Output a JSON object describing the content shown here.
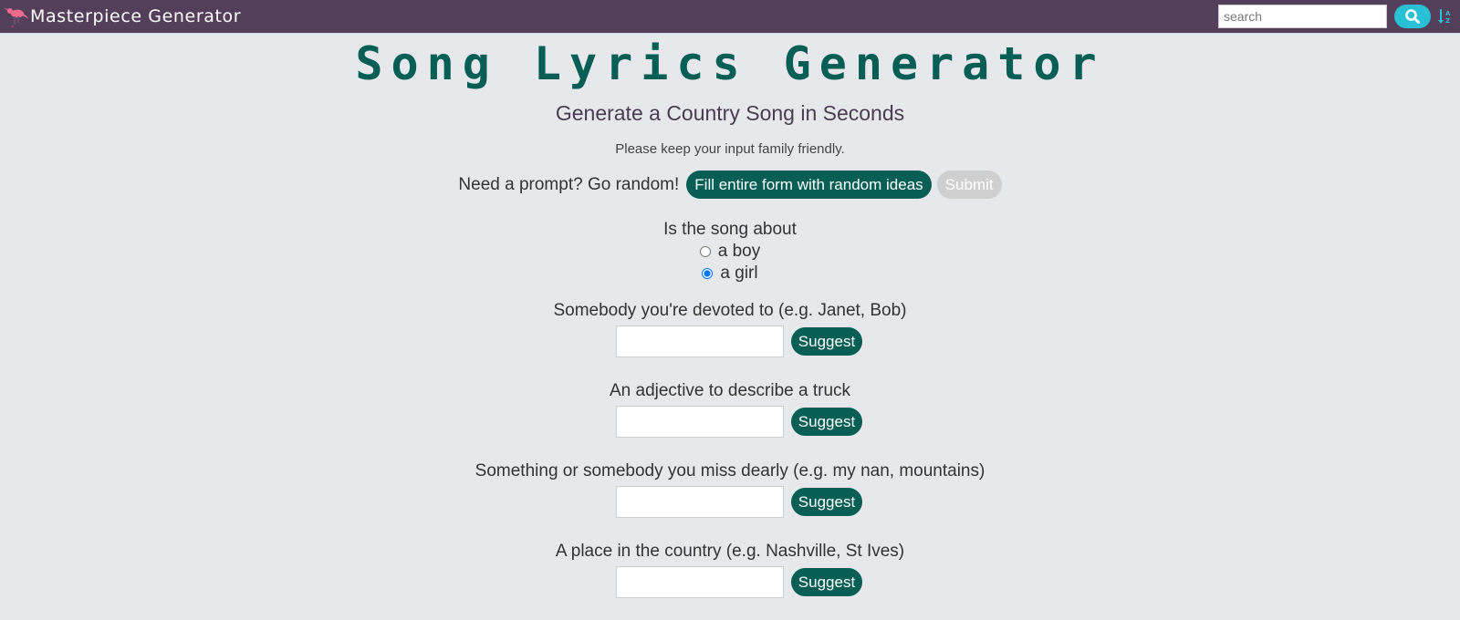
{
  "navbar": {
    "brand": "Masterpiece Generator",
    "search_placeholder": "search",
    "search_value": "",
    "icons": {
      "logo": "kangaroo-logo-icon",
      "search": "magnifier-icon",
      "sort": "sort-az-icon"
    },
    "colors": {
      "background": "#533f59",
      "search_button": "#29c0d6",
      "logo": "#f06a8c"
    }
  },
  "main": {
    "title": "Song Lyrics Generator",
    "subtitle": "Generate a Country Song in Seconds",
    "note": "Please keep your input family friendly.",
    "random_prompt": {
      "label": "Need a prompt? Go random!",
      "fill_button": "Fill entire form with random ideas",
      "submit_button": "Submit"
    },
    "gender_question": {
      "label": "Is the song about",
      "options": [
        {
          "label": "a boy",
          "checked": false
        },
        {
          "label": "a girl",
          "checked": true
        }
      ]
    },
    "fields": [
      {
        "label": "Somebody you're devoted to (e.g. Janet, Bob)",
        "value": "",
        "button": "Suggest"
      },
      {
        "label": "An adjective to describe a truck",
        "value": "",
        "button": "Suggest"
      },
      {
        "label": "Something or somebody you miss dearly (e.g. my nan, mountains)",
        "value": "",
        "button": "Suggest"
      },
      {
        "label": "A place in the country (e.g. Nashville, St Ives)",
        "value": "",
        "button": "Suggest"
      }
    ],
    "colors": {
      "accent": "#065e55",
      "background": "#e6e8ec",
      "disabled": "#cfcfcf"
    }
  }
}
